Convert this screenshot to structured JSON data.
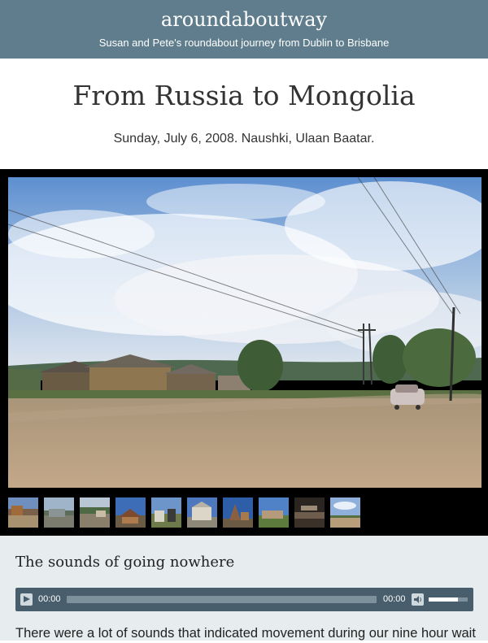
{
  "site": {
    "title": "aroundaboutway",
    "tagline": "Susan and Pete's roundabout journey from Dublin to Brisbane"
  },
  "post": {
    "title": "From Russia to Mongolia",
    "meta": "Sunday, July 6, 2008. Naushki, Ulaan Baatar."
  },
  "gallery": {
    "thumbnail_count": 10
  },
  "section": {
    "title": "The sounds of going nowhere"
  },
  "audio": {
    "current_time": "00:00",
    "duration": "00:00",
    "volume": 0.75
  },
  "body": {
    "first_line": "There were a lot of sounds that indicated movement during our nine hour wait"
  }
}
